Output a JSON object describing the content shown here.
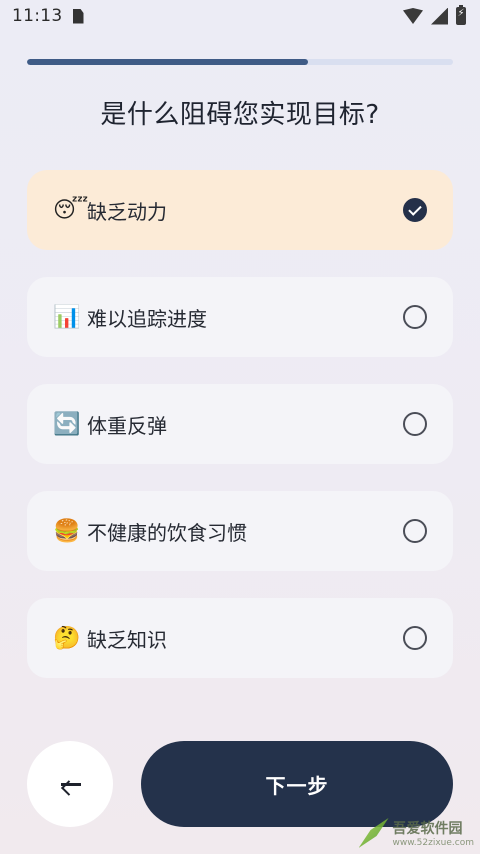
{
  "status_bar": {
    "time": "11:13",
    "icons": [
      "sim-card-icon",
      "wifi-icon",
      "signal-icon",
      "battery-charging-icon"
    ]
  },
  "progress": {
    "value": 0.66
  },
  "page": {
    "title": "是什么阻碍您实现目标?"
  },
  "options": [
    {
      "emoji": "😴",
      "icon": "sleepy-face-icon",
      "label": "缺乏动力",
      "selected": true
    },
    {
      "emoji": "📊",
      "icon": "bar-chart-icon",
      "label": "难以追踪进度",
      "selected": false
    },
    {
      "emoji": "🔄",
      "icon": "refresh-arrows-icon",
      "label": "体重反弹",
      "selected": false
    },
    {
      "emoji": "🍔",
      "icon": "burger-icon",
      "label": "不健康的饮食习惯",
      "selected": false
    },
    {
      "emoji": "🤔",
      "icon": "thinking-face-icon",
      "label": "缺乏知识",
      "selected": false
    }
  ],
  "footer": {
    "back_icon": "arrow-left-icon",
    "next_label": "下一步"
  },
  "watermark": {
    "name": "吾爱软件园",
    "url": "www.52zixue.com"
  },
  "colors": {
    "accent": "#24324b",
    "progress_fill": "#3f5b86",
    "progress_track": "#d9dff0",
    "selected_bg": "#fcebd7",
    "option_bg": "#f4f4f8"
  }
}
